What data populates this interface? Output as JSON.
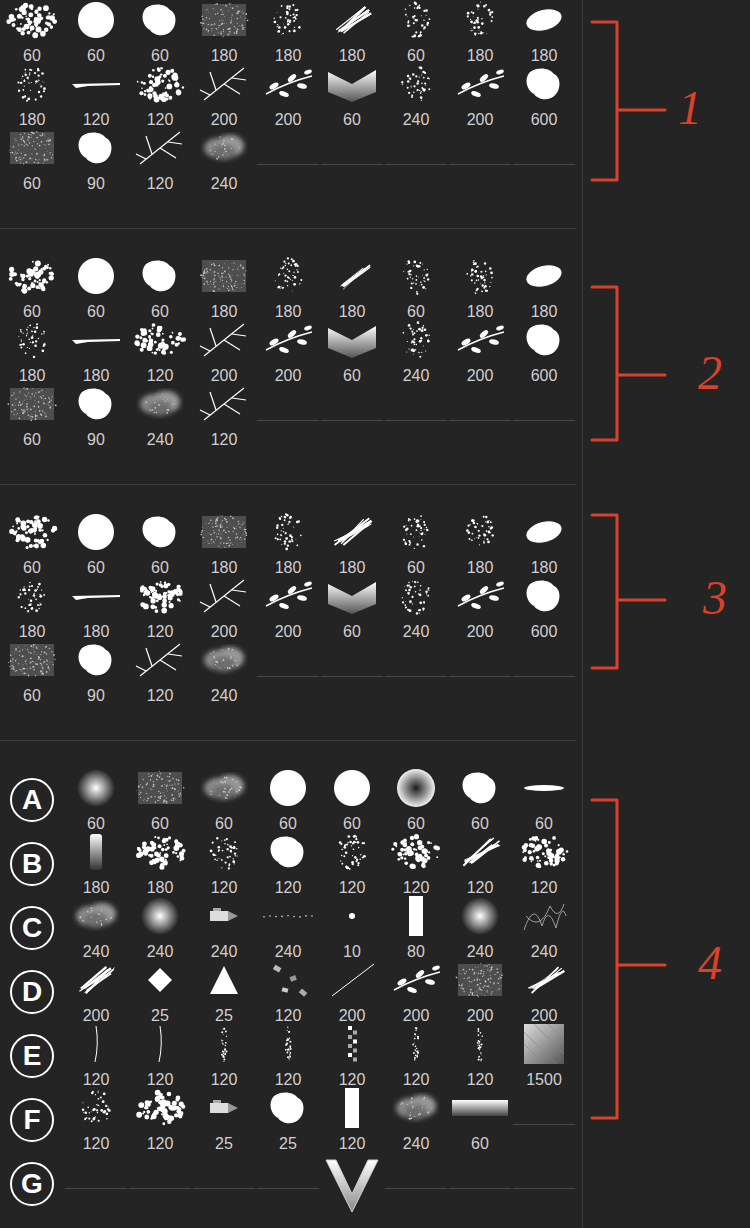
{
  "sections": [
    {
      "marker": "1",
      "brushes": [
        {
          "size": "60",
          "kind": "cluster"
        },
        {
          "size": "60",
          "kind": "hard-round"
        },
        {
          "size": "60",
          "kind": "blob"
        },
        {
          "size": "180",
          "kind": "texture"
        },
        {
          "size": "180",
          "kind": "speckle"
        },
        {
          "size": "180",
          "kind": "streak"
        },
        {
          "size": "60",
          "kind": "speckle"
        },
        {
          "size": "180",
          "kind": "speckle"
        },
        {
          "size": "180",
          "kind": "ellipse"
        },
        {
          "size": "180",
          "kind": "speckle"
        },
        {
          "size": "120",
          "kind": "line"
        },
        {
          "size": "120",
          "kind": "cluster"
        },
        {
          "size": "200",
          "kind": "branches"
        },
        {
          "size": "200",
          "kind": "leaves"
        },
        {
          "size": "60",
          "kind": "fold"
        },
        {
          "size": "240",
          "kind": "speckle"
        },
        {
          "size": "200",
          "kind": "leaves"
        },
        {
          "size": "600",
          "kind": "blob"
        },
        {
          "size": "60",
          "kind": "texture"
        },
        {
          "size": "90",
          "kind": "blob"
        },
        {
          "size": "120",
          "kind": "branches"
        },
        {
          "size": "240",
          "kind": "cloud"
        }
      ]
    },
    {
      "marker": "2",
      "brushes": [
        {
          "size": "60",
          "kind": "cluster"
        },
        {
          "size": "60",
          "kind": "hard-round"
        },
        {
          "size": "60",
          "kind": "blob"
        },
        {
          "size": "180",
          "kind": "texture"
        },
        {
          "size": "180",
          "kind": "speckle"
        },
        {
          "size": "180",
          "kind": "streak"
        },
        {
          "size": "60",
          "kind": "speckle"
        },
        {
          "size": "180",
          "kind": "speckle"
        },
        {
          "size": "180",
          "kind": "ellipse"
        },
        {
          "size": "180",
          "kind": "speckle"
        },
        {
          "size": "180",
          "kind": "line"
        },
        {
          "size": "120",
          "kind": "cluster"
        },
        {
          "size": "200",
          "kind": "branches"
        },
        {
          "size": "200",
          "kind": "leaves"
        },
        {
          "size": "60",
          "kind": "fold"
        },
        {
          "size": "240",
          "kind": "speckle"
        },
        {
          "size": "200",
          "kind": "leaves"
        },
        {
          "size": "600",
          "kind": "blob"
        },
        {
          "size": "60",
          "kind": "texture"
        },
        {
          "size": "90",
          "kind": "blob"
        },
        {
          "size": "240",
          "kind": "cloud"
        },
        {
          "size": "120",
          "kind": "branches"
        }
      ]
    },
    {
      "marker": "3",
      "brushes": [
        {
          "size": "60",
          "kind": "cluster"
        },
        {
          "size": "60",
          "kind": "hard-round"
        },
        {
          "size": "60",
          "kind": "blob"
        },
        {
          "size": "180",
          "kind": "texture"
        },
        {
          "size": "180",
          "kind": "speckle"
        },
        {
          "size": "180",
          "kind": "streak"
        },
        {
          "size": "60",
          "kind": "speckle"
        },
        {
          "size": "180",
          "kind": "speckle"
        },
        {
          "size": "180",
          "kind": "ellipse"
        },
        {
          "size": "180",
          "kind": "speckle"
        },
        {
          "size": "180",
          "kind": "line"
        },
        {
          "size": "120",
          "kind": "cluster"
        },
        {
          "size": "200",
          "kind": "branches"
        },
        {
          "size": "200",
          "kind": "leaves"
        },
        {
          "size": "60",
          "kind": "fold"
        },
        {
          "size": "240",
          "kind": "speckle"
        },
        {
          "size": "200",
          "kind": "leaves"
        },
        {
          "size": "600",
          "kind": "blob"
        },
        {
          "size": "60",
          "kind": "texture"
        },
        {
          "size": "90",
          "kind": "blob"
        },
        {
          "size": "120",
          "kind": "branches"
        },
        {
          "size": "240",
          "kind": "cloud"
        }
      ]
    }
  ],
  "lettered": {
    "marker": "4",
    "rows": [
      {
        "letter": "A",
        "brushes": [
          {
            "size": "60",
            "kind": "soft-round"
          },
          {
            "size": "60",
            "kind": "texture"
          },
          {
            "size": "60",
            "kind": "cloud"
          },
          {
            "size": "60",
            "kind": "hard-round"
          },
          {
            "size": "60",
            "kind": "hard-round"
          },
          {
            "size": "60",
            "kind": "radial-dark"
          },
          {
            "size": "60",
            "kind": "blob"
          },
          {
            "size": "60",
            "kind": "flat-ellipse"
          }
        ]
      },
      {
        "letter": "B",
        "brushes": [
          {
            "size": "180",
            "kind": "vgradient"
          },
          {
            "size": "180",
            "kind": "cluster"
          },
          {
            "size": "120",
            "kind": "speckle"
          },
          {
            "size": "120",
            "kind": "blob"
          },
          {
            "size": "120",
            "kind": "speckle"
          },
          {
            "size": "120",
            "kind": "cluster"
          },
          {
            "size": "120",
            "kind": "streak"
          },
          {
            "size": "120",
            "kind": "cluster"
          }
        ]
      },
      {
        "letter": "C",
        "brushes": [
          {
            "size": "240",
            "kind": "cloud"
          },
          {
            "size": "240",
            "kind": "soft-round"
          },
          {
            "size": "240",
            "kind": "tool"
          },
          {
            "size": "240",
            "kind": "dots-row"
          },
          {
            "size": "10",
            "kind": "tiny-dot"
          },
          {
            "size": "80",
            "kind": "bar"
          },
          {
            "size": "240",
            "kind": "soft-round"
          },
          {
            "size": "240",
            "kind": "scribble"
          }
        ]
      },
      {
        "letter": "D",
        "brushes": [
          {
            "size": "200",
            "kind": "streak"
          },
          {
            "size": "25",
            "kind": "diamond"
          },
          {
            "size": "25",
            "kind": "triangle"
          },
          {
            "size": "120",
            "kind": "confetti"
          },
          {
            "size": "200",
            "kind": "diag-line"
          },
          {
            "size": "200",
            "kind": "leaves"
          },
          {
            "size": "200",
            "kind": "texture"
          },
          {
            "size": "200",
            "kind": "streak"
          }
        ]
      },
      {
        "letter": "E",
        "brushes": [
          {
            "size": "120",
            "kind": "vline"
          },
          {
            "size": "120",
            "kind": "vline"
          },
          {
            "size": "120",
            "kind": "dotted"
          },
          {
            "size": "120",
            "kind": "dotted"
          },
          {
            "size": "120",
            "kind": "checker"
          },
          {
            "size": "120",
            "kind": "dotted"
          },
          {
            "size": "120",
            "kind": "dotted"
          },
          {
            "size": "1500",
            "kind": "diag-gradient"
          }
        ]
      },
      {
        "letter": "F",
        "brushes": [
          {
            "size": "120",
            "kind": "speckle"
          },
          {
            "size": "120",
            "kind": "cluster"
          },
          {
            "size": "25",
            "kind": "tool"
          },
          {
            "size": "25",
            "kind": "blob"
          },
          {
            "size": "120",
            "kind": "bar"
          },
          {
            "size": "240",
            "kind": "cloud"
          },
          {
            "size": "60",
            "kind": "hgradient"
          }
        ]
      },
      {
        "letter": "G",
        "brushes": []
      }
    ]
  }
}
